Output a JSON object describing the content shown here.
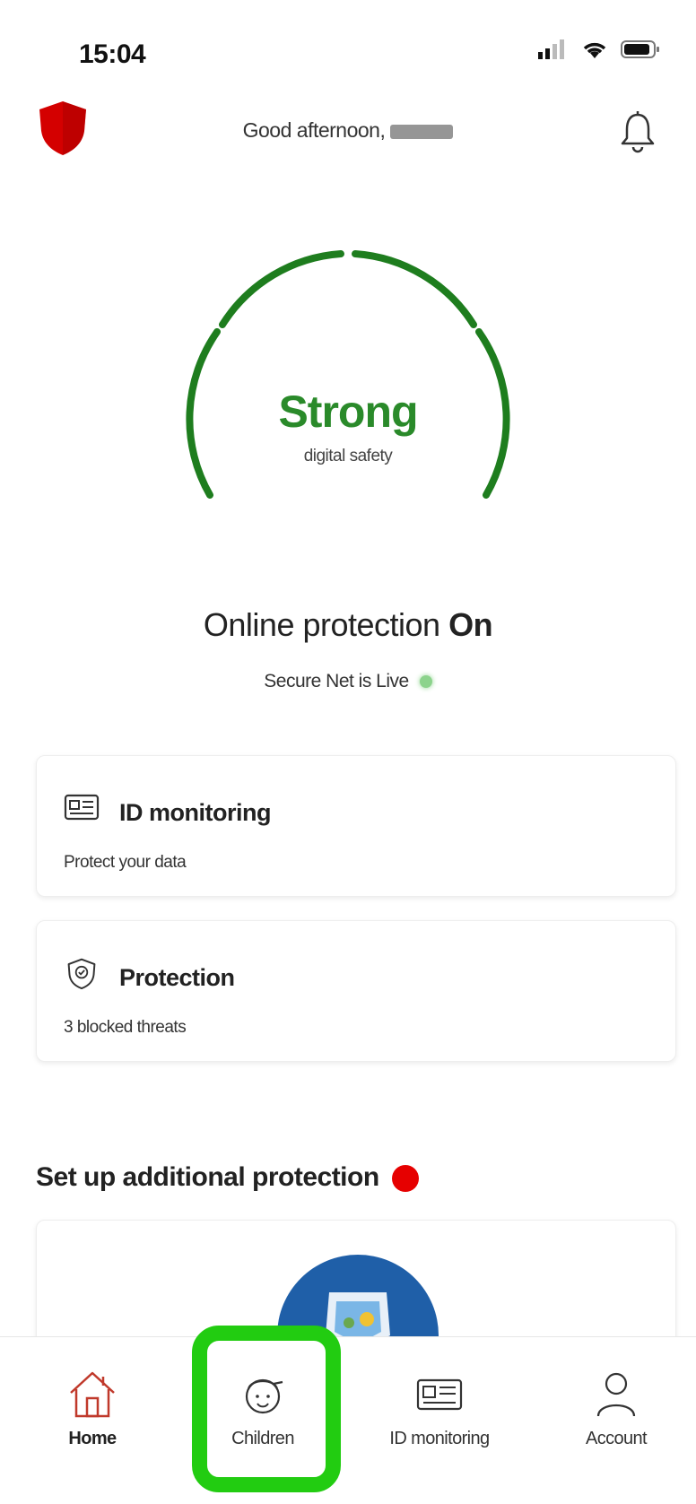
{
  "status_bar": {
    "time": "15:04",
    "icons": [
      "signal-icon",
      "wifi-icon",
      "battery-icon"
    ]
  },
  "header": {
    "greeting": "Good afternoon,",
    "logo_icon": "red-shield-icon",
    "notification_icon": "bell-icon"
  },
  "gauge": {
    "status": "Strong",
    "caption": "digital safety",
    "color": "#1e7d1e"
  },
  "protection": {
    "prefix": "Online protection",
    "state": "On",
    "secure_text": "Secure Net is Live",
    "live_color": "#8cd38c"
  },
  "cards": [
    {
      "title": "ID monitoring",
      "subtitle": "Protect your data",
      "icon": "id-card-icon"
    },
    {
      "title": "Protection",
      "subtitle": "3 blocked threats",
      "icon": "shield-check-icon"
    }
  ],
  "section": {
    "title": "Set up additional protection",
    "badge_color": "#e60000"
  },
  "bottom_nav": {
    "items": [
      {
        "label": "Home",
        "icon": "home-icon",
        "active": true
      },
      {
        "label": "Children",
        "icon": "child-face-icon",
        "active": false
      },
      {
        "label": "ID monitoring",
        "icon": "id-card-icon",
        "active": false
      },
      {
        "label": "Account",
        "icon": "person-icon",
        "active": false
      }
    ],
    "highlight_color": "#22cc11"
  },
  "colors": {
    "brand_red": "#e60000",
    "safe_green": "#1e7d1e"
  }
}
